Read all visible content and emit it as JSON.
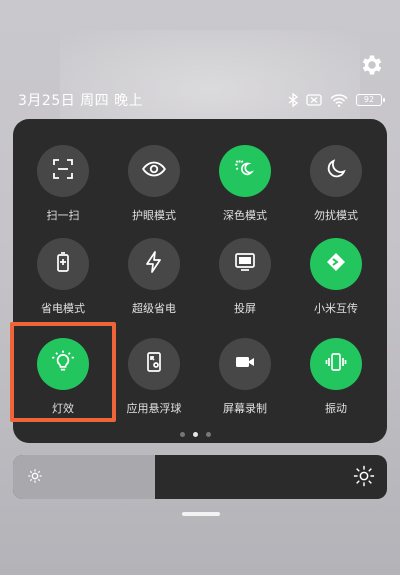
{
  "status_bar": {
    "date": "3月25日 周四 晚上",
    "battery": "92"
  },
  "tiles": [
    {
      "label": "扫一扫",
      "icon": "scan-icon",
      "on": false
    },
    {
      "label": "护眼模式",
      "icon": "eye-icon",
      "on": false
    },
    {
      "label": "深色模式",
      "icon": "dark-mode-icon",
      "on": true
    },
    {
      "label": "勿扰模式",
      "icon": "moon-icon",
      "on": false
    },
    {
      "label": "省电模式",
      "icon": "battery-saver-icon",
      "on": false
    },
    {
      "label": "超级省电",
      "icon": "lightning-icon",
      "on": false
    },
    {
      "label": "投屏",
      "icon": "cast-screen-icon",
      "on": false
    },
    {
      "label": "小米互传",
      "icon": "mi-share-icon",
      "on": true
    },
    {
      "label": "灯效",
      "icon": "light-bulb-icon",
      "on": true
    },
    {
      "label": "应用悬浮球",
      "icon": "floating-ball-icon",
      "on": false
    },
    {
      "label": "屏幕录制",
      "icon": "video-camera-icon",
      "on": false
    },
    {
      "label": "振动",
      "icon": "vibrate-icon",
      "on": true
    }
  ],
  "page_indicator": {
    "count": 3,
    "active_index": 1
  },
  "brightness": {
    "level_percent": 38
  },
  "colors": {
    "accent": "#22c55e",
    "panel": "#2b2b2b",
    "tile_off": "#474747",
    "highlight": "#f0643a"
  }
}
